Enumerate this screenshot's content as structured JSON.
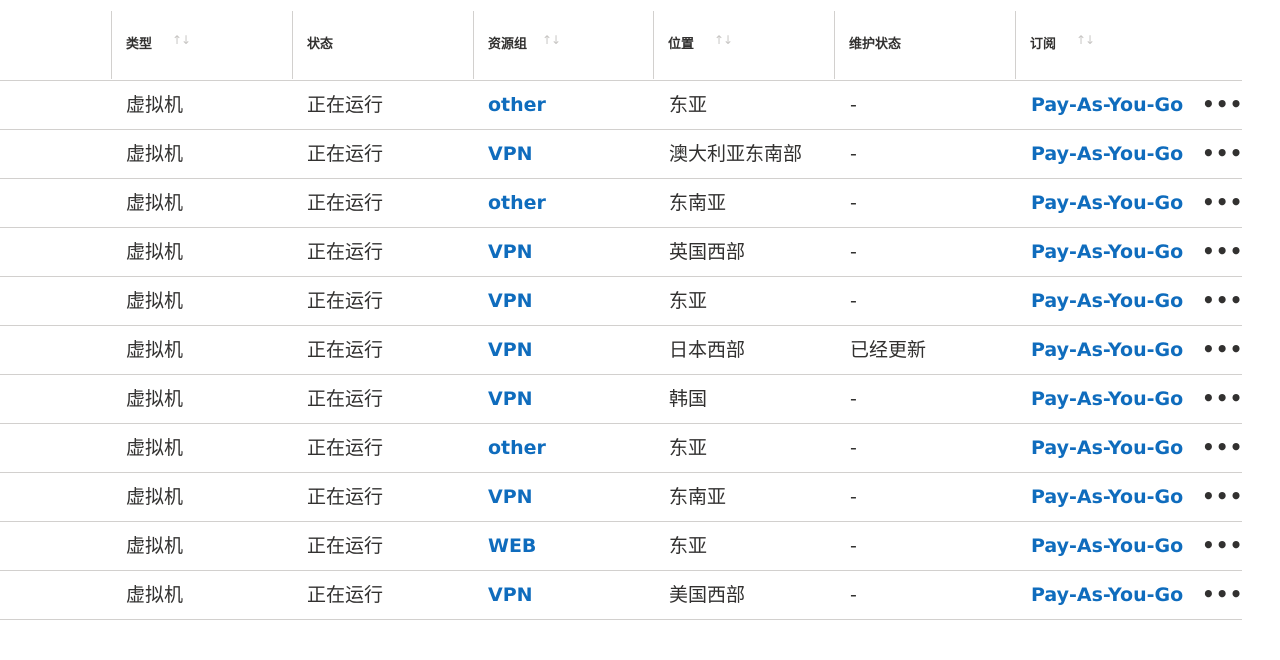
{
  "columns": [
    {
      "key": "type",
      "label": "类型",
      "sortable": true
    },
    {
      "key": "status",
      "label": "状态",
      "sortable": false
    },
    {
      "key": "resource_group",
      "label": "资源组",
      "sortable": true
    },
    {
      "key": "location",
      "label": "位置",
      "sortable": true
    },
    {
      "key": "maintenance",
      "label": "维护状态",
      "sortable": false
    },
    {
      "key": "subscription",
      "label": "订阅",
      "sortable": true
    }
  ],
  "sort_icon": "sort-arrows-icon",
  "more_icon": "more-horizontal-icon",
  "more_glyph": "•••",
  "sort_glyph": "↑↓",
  "link_color": "#0f6cbd",
  "rows": [
    {
      "type": "虚拟机",
      "status": "正在运行",
      "resource_group": "other",
      "location": "东亚",
      "maintenance": "-",
      "subscription": "Pay-As-You-Go"
    },
    {
      "type": "虚拟机",
      "status": "正在运行",
      "resource_group": "VPN",
      "location": "澳大利亚东南部",
      "maintenance": "-",
      "subscription": "Pay-As-You-Go"
    },
    {
      "type": "虚拟机",
      "status": "正在运行",
      "resource_group": "other",
      "location": "东南亚",
      "maintenance": "-",
      "subscription": "Pay-As-You-Go"
    },
    {
      "type": "虚拟机",
      "status": "正在运行",
      "resource_group": "VPN",
      "location": "英国西部",
      "maintenance": "-",
      "subscription": "Pay-As-You-Go"
    },
    {
      "type": "虚拟机",
      "status": "正在运行",
      "resource_group": "VPN",
      "location": "东亚",
      "maintenance": "-",
      "subscription": "Pay-As-You-Go"
    },
    {
      "type": "虚拟机",
      "status": "正在运行",
      "resource_group": "VPN",
      "location": "日本西部",
      "maintenance": "已经更新",
      "subscription": "Pay-As-You-Go"
    },
    {
      "type": "虚拟机",
      "status": "正在运行",
      "resource_group": "VPN",
      "location": "韩国",
      "maintenance": "-",
      "subscription": "Pay-As-You-Go"
    },
    {
      "type": "虚拟机",
      "status": "正在运行",
      "resource_group": "other",
      "location": "东亚",
      "maintenance": "-",
      "subscription": "Pay-As-You-Go"
    },
    {
      "type": "虚拟机",
      "status": "正在运行",
      "resource_group": "VPN",
      "location": "东南亚",
      "maintenance": "-",
      "subscription": "Pay-As-You-Go"
    },
    {
      "type": "虚拟机",
      "status": "正在运行",
      "resource_group": "WEB",
      "location": "东亚",
      "maintenance": "-",
      "subscription": "Pay-As-You-Go"
    },
    {
      "type": "虚拟机",
      "status": "正在运行",
      "resource_group": "VPN",
      "location": "美国西部",
      "maintenance": "-",
      "subscription": "Pay-As-You-Go"
    }
  ]
}
